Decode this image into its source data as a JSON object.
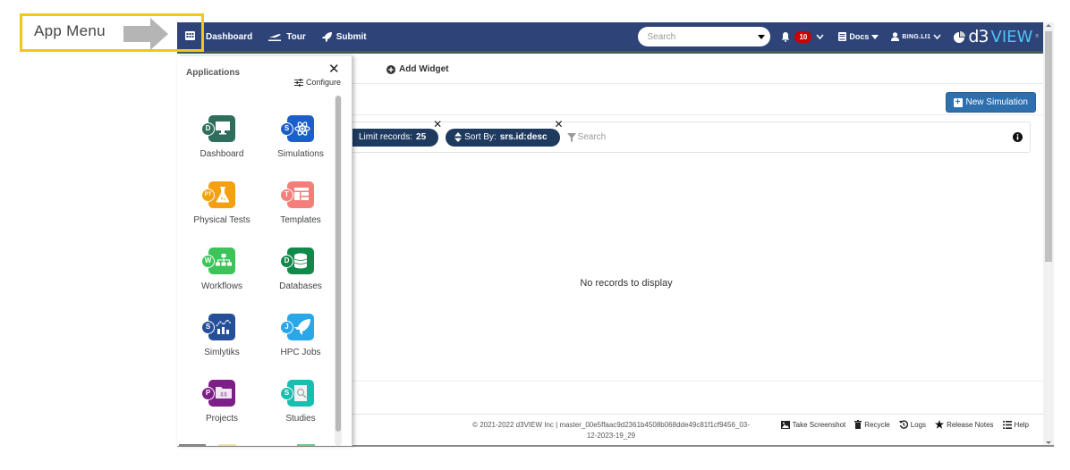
{
  "annotation": {
    "label": "App Menu",
    "highlight_color": "#f5c518"
  },
  "topnav": {
    "items": [
      {
        "label": "Dashboard",
        "icon": "grid-icon"
      },
      {
        "label": "Tour",
        "icon": "plane-icon"
      },
      {
        "label": "Submit",
        "icon": "rocket-icon"
      }
    ],
    "search_placeholder": "Search",
    "notifications_count": "10",
    "docs_label": "Docs",
    "user_label": "BING.LI1",
    "logo_d3": "d3",
    "logo_view": "VIEW",
    "bg_color": "#2e4478"
  },
  "app_menu": {
    "title": "Applications",
    "configure_label": "Configure",
    "apps": [
      {
        "label": "Dashboard",
        "letter": "D",
        "color": "#2f6e5c",
        "icon": "monitor-icon"
      },
      {
        "label": "Simulations",
        "letter": "S",
        "color": "#1c5fc8",
        "icon": "atom-icon"
      },
      {
        "label": "Physical Tests",
        "letter": "PT",
        "color": "#f5a012",
        "icon": "flask-icon"
      },
      {
        "label": "Templates",
        "letter": "T",
        "color": "#f47f7a",
        "icon": "template-icon"
      },
      {
        "label": "Workflows",
        "letter": "W",
        "color": "#3cc45a",
        "icon": "hierarchy-icon"
      },
      {
        "label": "Databases",
        "letter": "D",
        "color": "#11894a",
        "icon": "database-icon"
      },
      {
        "label": "Simlytiks",
        "letter": "S",
        "color": "#264f9a",
        "icon": "analytics-icon"
      },
      {
        "label": "HPC Jobs",
        "letter": "J",
        "color": "#2aa7e8",
        "icon": "rocket-icon"
      },
      {
        "label": "Projects",
        "letter": "P",
        "color": "#7d1f86",
        "icon": "folder-icon"
      },
      {
        "label": "Studies",
        "letter": "S",
        "color": "#19bfae",
        "icon": "magnifier-doc-icon"
      }
    ]
  },
  "main": {
    "add_widget_label": "Add Widget",
    "new_simulation_label": "New Simulation",
    "filters": {
      "limit_label": "Limit records:",
      "limit_value": "25",
      "sort_label": "Sort By:",
      "sort_value": "srs.id:desc",
      "search_placeholder": "Search"
    },
    "empty_message": "No records to display"
  },
  "footer": {
    "copyright_line1": "© 2021-2022 d3VIEW Inc | master_00e5ffaac9d2361b4508b068dde49c81f1cf9456_03-",
    "copyright_line2": "12-2023-19_29",
    "links": [
      {
        "label": "Take Screenshot",
        "icon": "image-icon"
      },
      {
        "label": "Recycle",
        "icon": "trash-icon"
      },
      {
        "label": "Logs",
        "icon": "history-icon"
      },
      {
        "label": "Release Notes",
        "icon": "star-icon"
      },
      {
        "label": "Help",
        "icon": "list-icon"
      }
    ]
  }
}
